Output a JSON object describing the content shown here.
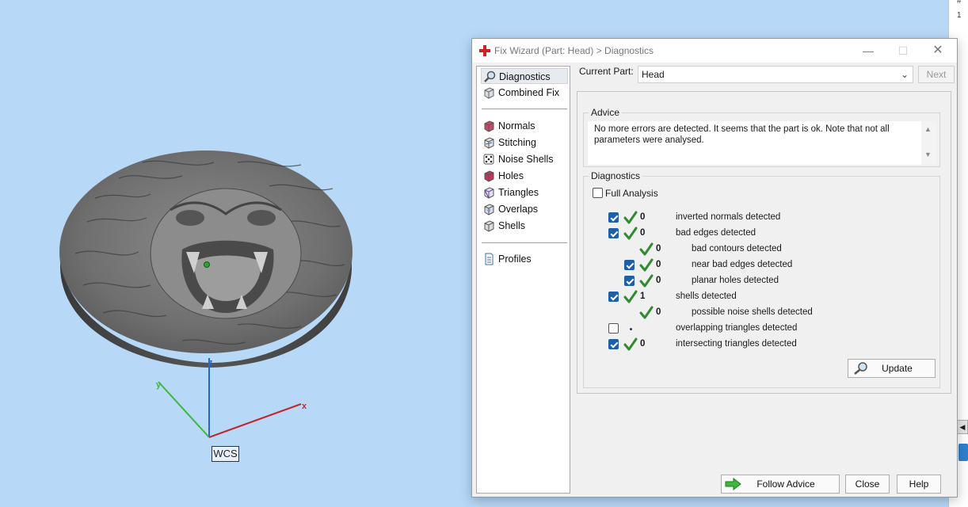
{
  "viewport": {
    "wcs_label": "WCS",
    "axis_x": "x",
    "axis_y": "y",
    "axis_z": "z"
  },
  "right_strip": {
    "line1": "#",
    "line2": "1",
    "scroll_glyph": "◀"
  },
  "dialog": {
    "title": "Fix Wizard (Part: Head) > Diagnostics",
    "sidebar_items": [
      {
        "label": "Diagnostics",
        "icon": "magnifier-icon",
        "active": true
      },
      {
        "label": "Combined Fix",
        "icon": "cube-icon"
      },
      {
        "label": "Normals",
        "icon": "normals-cube-icon"
      },
      {
        "label": "Stitching",
        "icon": "stitching-cube-icon"
      },
      {
        "label": "Noise Shells",
        "icon": "dice-icon"
      },
      {
        "label": "Holes",
        "icon": "holes-cube-icon"
      },
      {
        "label": "Triangles",
        "icon": "triangles-cube-icon"
      },
      {
        "label": "Overlaps",
        "icon": "overlaps-cube-icon"
      },
      {
        "label": "Shells",
        "icon": "shells-cube-icon"
      },
      {
        "label": "Profiles",
        "icon": "document-icon"
      }
    ],
    "current_part_label": "Current Part:",
    "current_part_value": "Head",
    "next_button": "Next",
    "advice_title": "Advice",
    "advice_text": "No more errors are detected. It seems that the part is ok. Note that not all parameters were analysed.",
    "diagnostics_title": "Diagnostics",
    "full_analysis_label": "Full Analysis",
    "full_analysis_checked": false,
    "rows": [
      {
        "checked": true,
        "count": "0",
        "label": "inverted normals detected",
        "ok": true
      },
      {
        "checked": true,
        "count": "0",
        "label": "bad edges detected",
        "ok": true
      },
      {
        "checked": null,
        "count": "0",
        "label": "bad contours detected",
        "ok": true
      },
      {
        "checked": true,
        "count": "0",
        "label": "near bad edges detected",
        "ok": true
      },
      {
        "checked": true,
        "count": "0",
        "label": "planar holes detected",
        "ok": true
      },
      {
        "checked": true,
        "count": "1",
        "label": "shells detected",
        "ok": true
      },
      {
        "checked": null,
        "count": "0",
        "label": "possible noise shells detected",
        "ok": true
      },
      {
        "checked": false,
        "count": "",
        "label": "overlapping triangles detected",
        "ok": false
      },
      {
        "checked": true,
        "count": "0",
        "label": "intersecting triangles detected",
        "ok": true
      }
    ],
    "update_button": "Update",
    "follow_advice_button": "Follow Advice",
    "close_button": "Close",
    "help_button": "Help"
  },
  "colors": {
    "viewport_bg": "#b7d9f7",
    "check_green": "#2e8b2e",
    "checkbox_blue": "#1f5fa8",
    "axis_x": "#c0282d",
    "axis_y": "#3cb83c",
    "axis_z": "#2a68c8"
  }
}
